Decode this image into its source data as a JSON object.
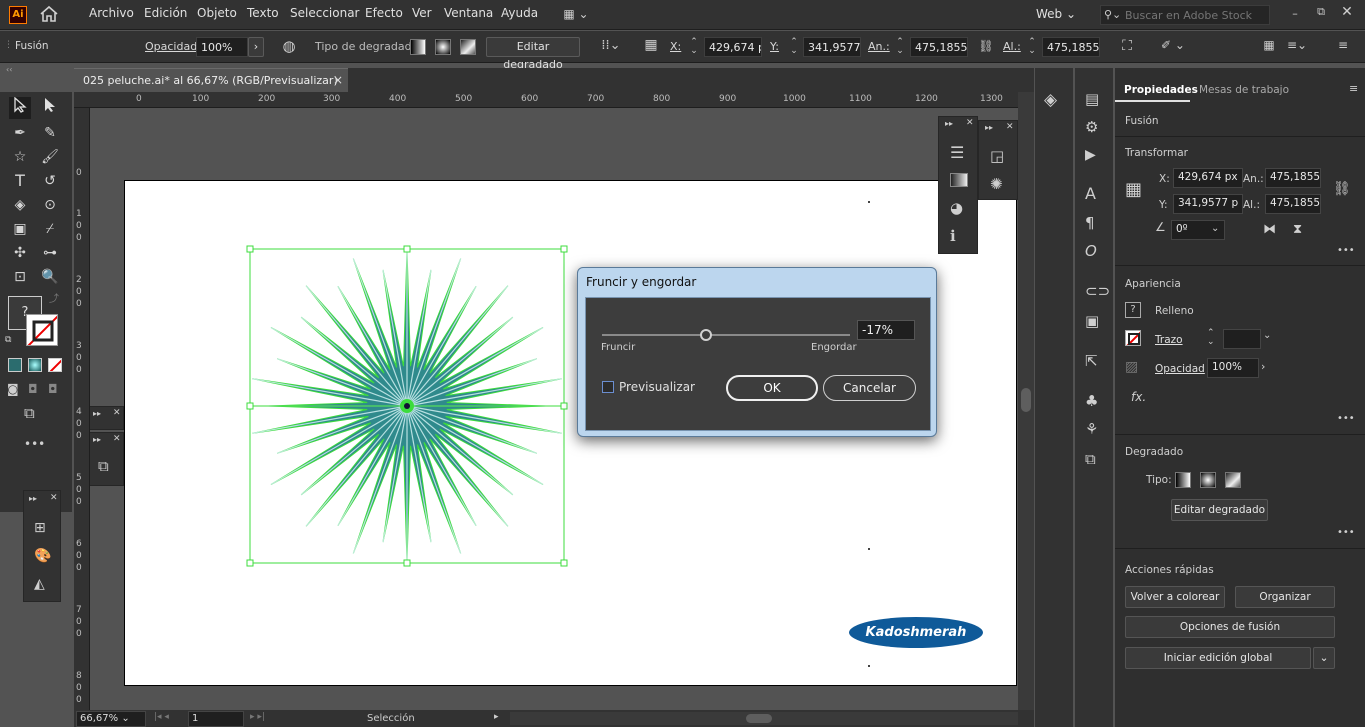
{
  "app": {
    "logo": "Ai",
    "workspace": "Web",
    "search_placeholder": "Buscar en Adobe Stock"
  },
  "menu": [
    "Archivo",
    "Edición",
    "Objeto",
    "Texto",
    "Seleccionar",
    "Efecto",
    "Ver",
    "Ventana",
    "Ayuda"
  ],
  "control": {
    "object_type": "Fusión",
    "opacity_label": "Opacidad:",
    "opacity_value": "100%",
    "gradient_label": "Tipo de degradado:",
    "edit_gradient": "Editar degradado",
    "x_label": "X:",
    "x_value": "429,674 px",
    "y_label": "Y:",
    "y_value": "341,9577 px",
    "w_label": "An.:",
    "w_value": "475,1855 px",
    "h_label": "Al.:",
    "h_value": "475,1855 px"
  },
  "document": {
    "tab_title": "025 peluche.ai* al 66,67% (RGB/Previsualizar)",
    "close": "×"
  },
  "ruler_h": [
    "0",
    "100",
    "200",
    "300",
    "400",
    "500",
    "600",
    "700",
    "800",
    "900",
    "1000",
    "1100",
    "1200",
    "1300"
  ],
  "ruler_v": [
    "0",
    "1\n0\n0",
    "2\n0\n0",
    "3\n0\n0",
    "4\n0\n0",
    "5\n0\n0",
    "6\n0\n0",
    "7\n0\n0",
    "8\n0\n0"
  ],
  "status": {
    "zoom": "66,67%",
    "page": "1",
    "tool": "Selección"
  },
  "fill_stroke": {
    "unknown": "?"
  },
  "dialog": {
    "title": "Fruncir y engordar",
    "value": "-17%",
    "left_label": "Fruncir",
    "right_label": "Engordar",
    "preview_label": "Previsualizar",
    "ok": "OK",
    "cancel": "Cancelar",
    "slider_fraction": 0.42
  },
  "watermark": "Kadoshmerah",
  "properties": {
    "tab_active": "Propiedades",
    "tab_other": "Mesas de trabajo",
    "object": "Fusión",
    "transform_title": "Transformar",
    "x_label": "X:",
    "x_value": "429,674 px",
    "y_label": "Y:",
    "y_value": "341,9577 p",
    "w_label": "An.:",
    "w_value": "475,1855 p:",
    "h_label": "Al.:",
    "h_value": "475,1855 p:",
    "angle_value": "0º",
    "appearance_title": "Apariencia",
    "fill_label": "Relleno",
    "stroke_label": "Trazo",
    "opacity_label": "Opacidad",
    "opacity_value": "100%",
    "fx": "fx.",
    "gradient_title": "Degradado",
    "gradient_type_label": "Tipo:",
    "edit_gradient": "Editar degradado",
    "quick_actions_title": "Acciones rápidas",
    "recolor": "Volver a colorear",
    "arrange": "Organizar",
    "blend_options": "Opciones de fusión",
    "global_edit": "Iniciar edición global",
    "more": "•••"
  },
  "colors": {
    "accent_green": "#3cdc3c",
    "star_teal": "#2f8a8c",
    "dialog_blue": "#bcd6ee",
    "logo_blue": "#0f5a99"
  }
}
